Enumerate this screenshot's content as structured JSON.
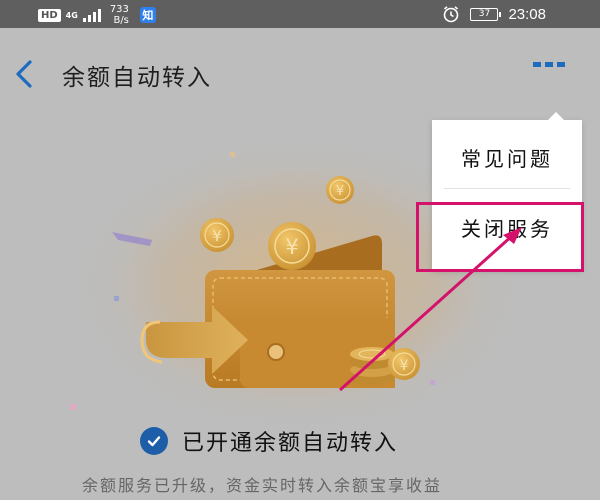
{
  "status_bar": {
    "hd": "HD",
    "network": "4G",
    "speed_value": "733",
    "speed_unit": "B/s",
    "app_badge": "知",
    "battery": "37",
    "time": "23:08",
    "icons": [
      "signal-icon",
      "alarm-icon",
      "battery-icon"
    ]
  },
  "header": {
    "title": "余额自动转入",
    "back_icon": "chevron-left-icon",
    "more_icon": "more-dots-icon",
    "accent_color": "#1c6bbf"
  },
  "hero": {
    "illustration": "wallet-with-coins-illustration",
    "coin_symbol": "¥"
  },
  "status": {
    "enabled_label": "已开通余额自动转入",
    "check_icon": "check-circle-icon",
    "description": "余额服务已升级，资金实时转入余额宝享收益"
  },
  "menu": {
    "items": [
      {
        "label": "常见问题"
      },
      {
        "label": "关闭服务"
      }
    ]
  },
  "annotation": {
    "color": "#d4116b",
    "highlighted_item": "关闭服务"
  }
}
